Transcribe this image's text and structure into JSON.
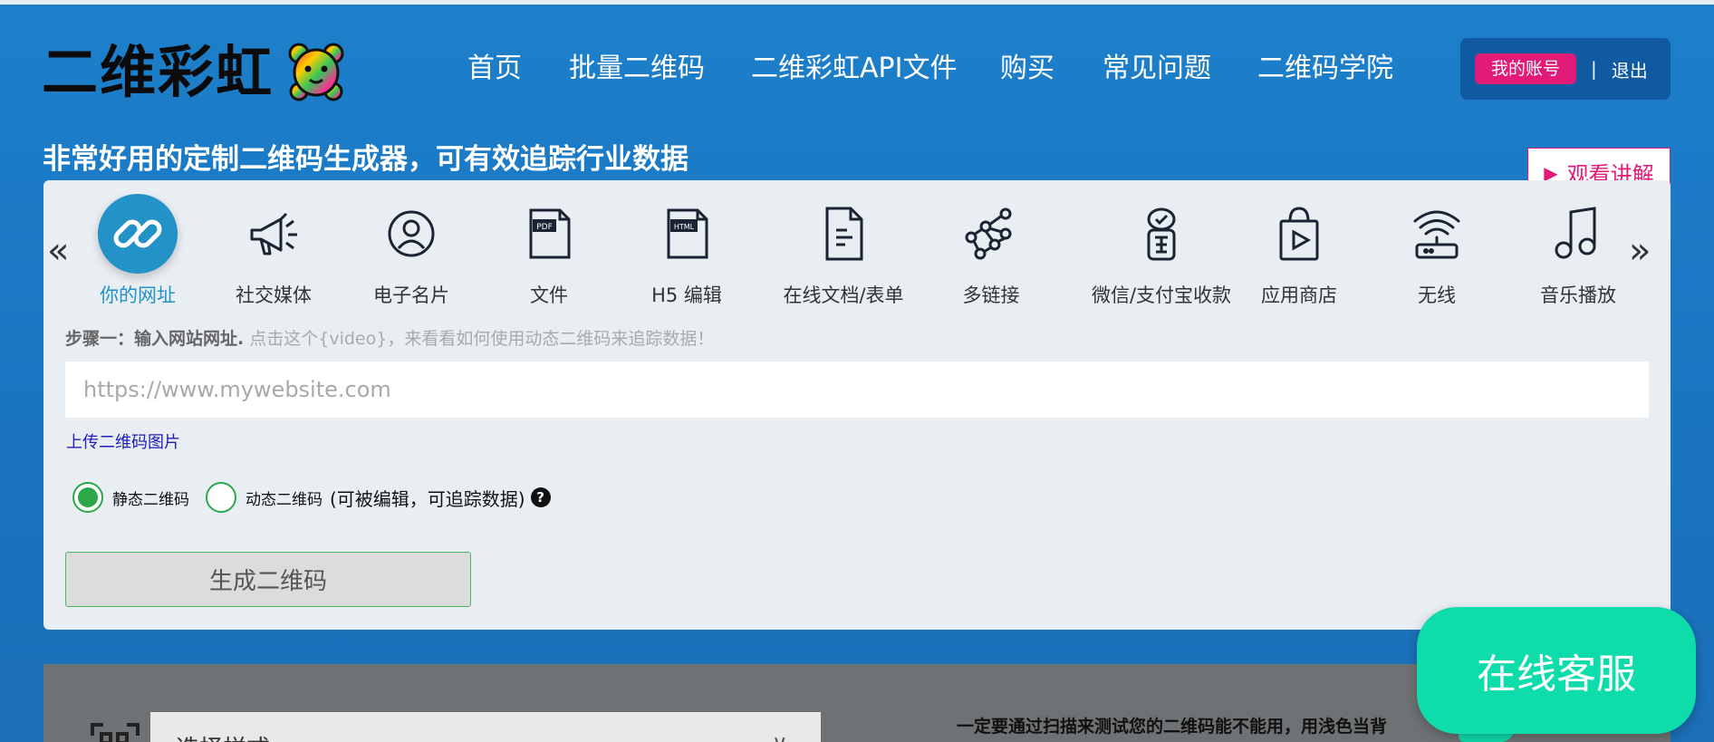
{
  "logo": {
    "text": "二维彩虹",
    "icon": "rainbow-bear-icon"
  },
  "nav": [
    {
      "label": "首页"
    },
    {
      "label": "批量二维码"
    },
    {
      "label": "二维彩虹API文件"
    },
    {
      "label": "购买"
    },
    {
      "label": "常见问题"
    },
    {
      "label": "二维码学院"
    }
  ],
  "account": {
    "my_account": "我的账号",
    "separator": "|",
    "logout": "退出"
  },
  "tagline": "非常好用的定制二维码生成器，可有效追踪行业数据",
  "watch": {
    "label": "观看讲解",
    "icon": "play-triangle-icon"
  },
  "carousel": {
    "prev": "«",
    "next": "»",
    "items": [
      {
        "label": "你的网址",
        "icon": "link-icon",
        "active": true
      },
      {
        "label": "社交媒体",
        "icon": "megaphone-icon"
      },
      {
        "label": "电子名片",
        "icon": "user-circle-icon"
      },
      {
        "label": "文件",
        "icon": "pdf-icon",
        "badge": "PDF"
      },
      {
        "label": "H5 编辑",
        "icon": "html-icon",
        "badge": "HTML"
      },
      {
        "label": "在线文档/表单",
        "icon": "document-icon"
      },
      {
        "label": "多链接",
        "icon": "network-icon"
      },
      {
        "label": "微信/支付宝收款",
        "icon": "payment-icon"
      },
      {
        "label": "应用商店",
        "icon": "app-store-bag-icon"
      },
      {
        "label": "无线",
        "icon": "wifi-router-icon"
      },
      {
        "label": "音乐播放",
        "icon": "music-note-icon"
      }
    ]
  },
  "step": {
    "bold": "步骤一：输入网站网址.",
    "hint": " 点击这个{video}，来看看如何使用动态二维码来追踪数据！"
  },
  "url_input": {
    "placeholder": "https://www.mywebsite.com",
    "value": ""
  },
  "upload_link": "上传二维码图片",
  "qr_type": {
    "static_label": "静态二维码",
    "dynamic_label": "动态二维码",
    "dynamic_extra": "(可被编辑，可追踪数据)",
    "help": "?",
    "selected": "static"
  },
  "generate_button": "生成二维码",
  "style_select": {
    "label": "选择样式",
    "icon": "qr-scan-icon",
    "chevron": "∨"
  },
  "lower_note": "一定要通过扫描来测试您的二维码能不能用，用浅色当背",
  "online_service": "在线客服",
  "colors": {
    "accent": "#2392c6",
    "pink": "#e21b78",
    "service": "#0fdcab",
    "radio": "#2ca84b"
  }
}
